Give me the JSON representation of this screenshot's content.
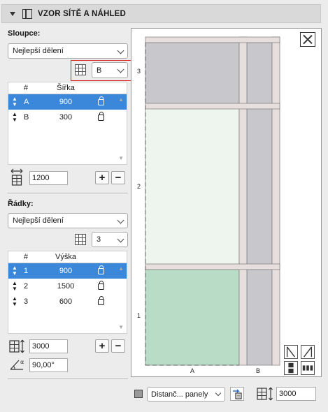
{
  "header": {
    "title": "VZOR SÍTĚ A NÁHLED"
  },
  "columns": {
    "label": "Sloupce:",
    "division": "Nejlepší dělení",
    "selected_letter": "B",
    "table": {
      "headers": [
        "#",
        "Šířka"
      ],
      "rows": [
        {
          "id": "A",
          "value": "900",
          "selected": true
        },
        {
          "id": "B",
          "value": "300",
          "selected": false
        }
      ]
    },
    "total": "1200"
  },
  "rows": {
    "label": "Řádky:",
    "division": "Nejlepší dělení",
    "count": "3",
    "table": {
      "headers": [
        "#",
        "Výška"
      ],
      "rows": [
        {
          "id": "1",
          "value": "900",
          "selected": true
        },
        {
          "id": "2",
          "value": "1500",
          "selected": false
        },
        {
          "id": "3",
          "value": "600",
          "selected": false
        }
      ]
    },
    "total": "3000",
    "angle": "90,00°"
  },
  "preview": {
    "row_labels": [
      "3",
      "2",
      "1"
    ],
    "col_labels": [
      "A",
      "B"
    ]
  },
  "footer": {
    "panels_select": "Distanč... panely",
    "height": "3000"
  },
  "colors": {
    "selection": "#3b87d9",
    "panel_gray": "#c8c7cb",
    "panel_light_green": "#eef5ef",
    "panel_green": "#b8dcc6",
    "frame": "#e7dede",
    "highlight_red": "#e02020"
  }
}
